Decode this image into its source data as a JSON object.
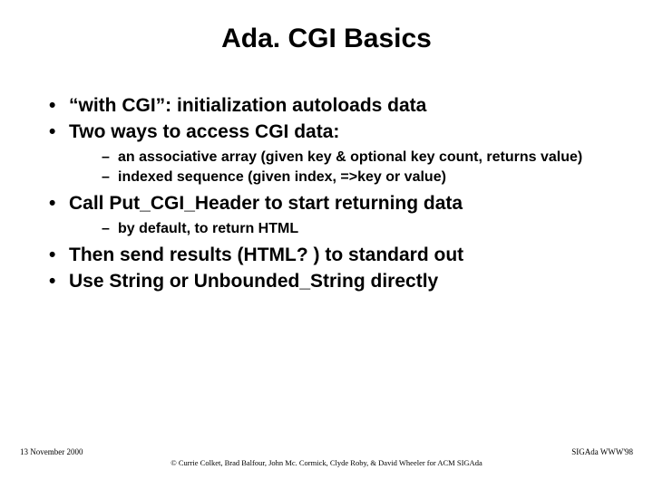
{
  "title": "Ada. CGI Basics",
  "bullets": [
    {
      "text": "“with CGI”: initialization autoloads data"
    },
    {
      "text": "Two ways to access CGI data:",
      "sub": [
        "an associative array (given key & optional key count, returns value)",
        "indexed sequence (given index, =>key or value)"
      ]
    },
    {
      "text": "Call Put_CGI_Header to start returning data",
      "sub": [
        "by default, to return HTML"
      ]
    },
    {
      "text": "Then send results (HTML? ) to standard out"
    },
    {
      "text": "Use String or Unbounded_String directly"
    }
  ],
  "footer": {
    "date": "13 November 2000",
    "right": "SIGAda WWW'98",
    "attribution": "© Currie Colket, Brad Balfour, John Mc. Cormick, Clyde Roby, & David Wheeler for ACM SIGAda"
  }
}
